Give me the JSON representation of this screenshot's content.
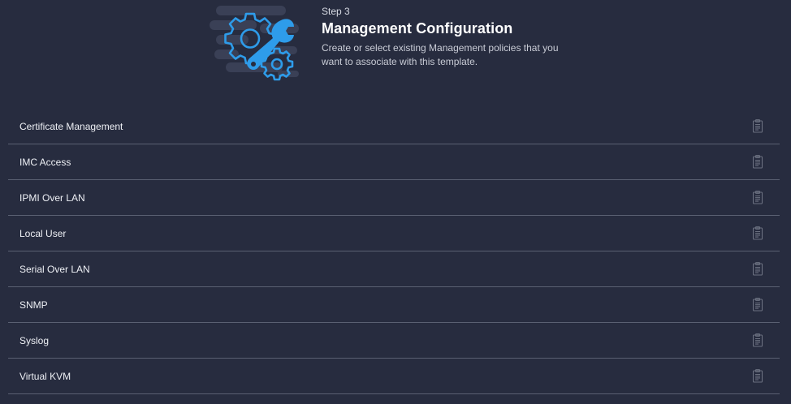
{
  "header": {
    "step_label": "Step 3",
    "title": "Management Configuration",
    "description": "Create or select existing Management policies that you want to associate with this template.",
    "illustration_icon": "gears-wrench-icon"
  },
  "policies": [
    {
      "label": "Certificate Management",
      "icon": "document-icon"
    },
    {
      "label": "IMC Access",
      "icon": "document-icon"
    },
    {
      "label": "IPMI Over LAN",
      "icon": "document-icon"
    },
    {
      "label": "Local User",
      "icon": "document-icon"
    },
    {
      "label": "Serial Over LAN",
      "icon": "document-icon"
    },
    {
      "label": "SNMP",
      "icon": "document-icon"
    },
    {
      "label": "Syslog",
      "icon": "document-icon"
    },
    {
      "label": "Virtual KVM",
      "icon": "document-icon"
    }
  ],
  "colors": {
    "background": "#272c3f",
    "accent": "#2e9cea",
    "divider": "#5a6072",
    "icon_muted": "#6b7080"
  }
}
